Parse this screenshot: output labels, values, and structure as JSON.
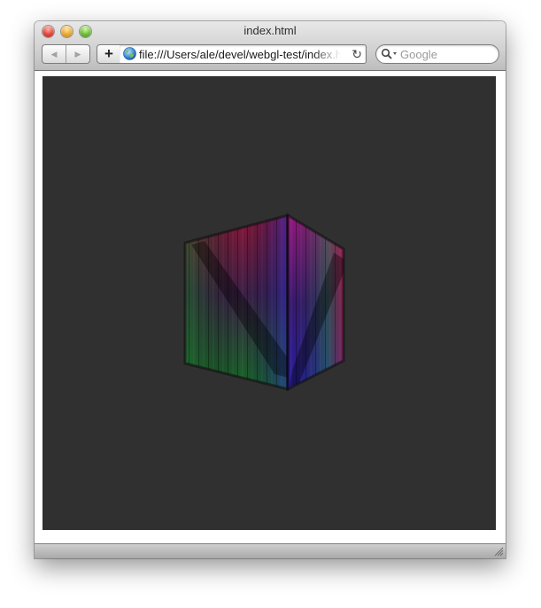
{
  "window": {
    "title": "index.html"
  },
  "toolbar": {
    "back_icon": "◀",
    "forward_icon": "▶",
    "add_label": "+",
    "url": "file:///Users/ale/devel/webgl-test/index.html",
    "reload_icon": "↻",
    "search_placeholder": "Google",
    "search_value": ""
  },
  "content": {
    "canvas_color": "#303030",
    "scene": "textured-cube"
  },
  "icons": [
    "close-icon",
    "minimize-icon",
    "zoom-icon",
    "back-icon",
    "forward-icon",
    "add-bookmark-icon",
    "globe-icon",
    "reload-icon",
    "search-icon",
    "resize-grip-icon"
  ]
}
